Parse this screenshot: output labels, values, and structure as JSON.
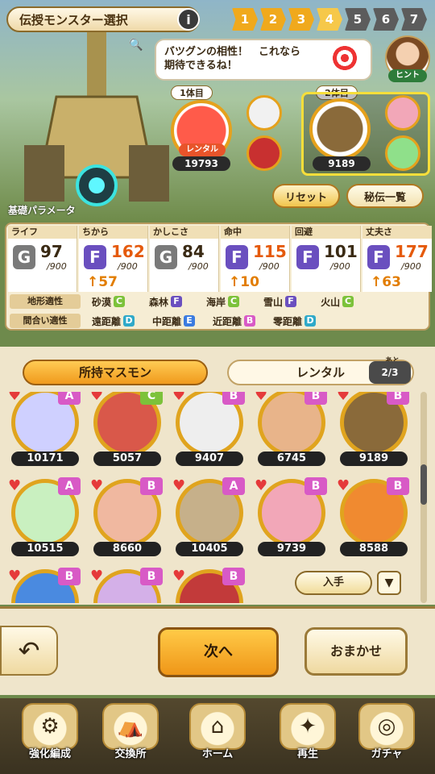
{
  "header": {
    "title": "伝授モンスター選択",
    "info_label": "i",
    "steps": [
      "1",
      "2",
      "3",
      "4",
      "5",
      "6",
      "7"
    ]
  },
  "hint": {
    "text_line1": "バツグンの相性！　これなら",
    "text_line2": "期待できるね！",
    "label": "ヒント"
  },
  "slots": {
    "slot1_label": "1体目",
    "slot1_rental": "レンタル",
    "slot1_id": "19793",
    "slot2_label": "2体目",
    "slot2_id": "9189"
  },
  "buttons": {
    "reset": "リセット",
    "secret": "秘伝一覧",
    "get": "入手",
    "next": "次へ",
    "auto": "おまかせ"
  },
  "base_params_label": "基礎パラメータ",
  "params": [
    {
      "name": "ライフ",
      "grade": "G",
      "value": "97",
      "max": "/900",
      "up": ""
    },
    {
      "name": "ちから",
      "grade": "F",
      "value": "162",
      "max": "/900",
      "up": "57"
    },
    {
      "name": "かしこさ",
      "grade": "G",
      "value": "84",
      "max": "/900",
      "up": ""
    },
    {
      "name": "命中",
      "grade": "F",
      "value": "115",
      "max": "/900",
      "up": "10"
    },
    {
      "name": "回避",
      "grade": "F",
      "value": "101",
      "max": "/900",
      "up": ""
    },
    {
      "name": "丈夫さ",
      "grade": "F",
      "value": "177",
      "max": "/900",
      "up": "63"
    }
  ],
  "terrain": {
    "label": "地形適性",
    "items": [
      {
        "name": "砂漠",
        "grade": "C"
      },
      {
        "name": "森林",
        "grade": "F"
      },
      {
        "name": "海岸",
        "grade": "C"
      },
      {
        "name": "雪山",
        "grade": "F"
      },
      {
        "name": "火山",
        "grade": "C"
      }
    ]
  },
  "range": {
    "label": "間合い適性",
    "items": [
      {
        "name": "遠距離",
        "grade": "D"
      },
      {
        "name": "中距離",
        "grade": "E"
      },
      {
        "name": "近距離",
        "grade": "B"
      },
      {
        "name": "零距離",
        "grade": "D"
      }
    ]
  },
  "tabs": {
    "owned": "所持マスモン",
    "rental": "レンタル",
    "rental_count": "2/3",
    "ato": "あと"
  },
  "monsters": [
    {
      "id": "10171",
      "grade": "A"
    },
    {
      "id": "5057",
      "grade": "C"
    },
    {
      "id": "9407",
      "grade": "B"
    },
    {
      "id": "6745",
      "grade": "B"
    },
    {
      "id": "9189",
      "grade": "B"
    },
    {
      "id": "10515",
      "grade": "A"
    },
    {
      "id": "8660",
      "grade": "B"
    },
    {
      "id": "10405",
      "grade": "A"
    },
    {
      "id": "9739",
      "grade": "B"
    },
    {
      "id": "8588",
      "grade": "B"
    },
    {
      "id": "",
      "grade": "B"
    },
    {
      "id": "",
      "grade": "B"
    },
    {
      "id": "",
      "grade": "B"
    }
  ],
  "nav": [
    "強化編成",
    "交換所",
    "ホーム",
    "再生",
    "ガチャ"
  ]
}
